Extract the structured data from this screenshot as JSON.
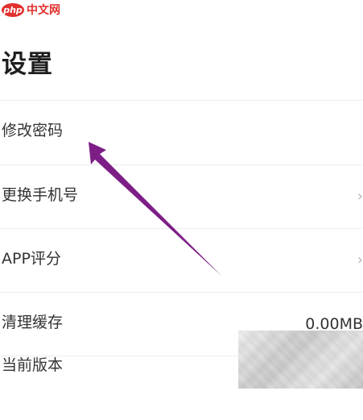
{
  "watermark": {
    "logo_text": "php",
    "site_text": "中文网"
  },
  "header": {
    "title": "设置"
  },
  "settings": {
    "items": [
      {
        "label": "修改密码"
      },
      {
        "label": "更换手机号"
      },
      {
        "label": "APP评分"
      },
      {
        "label": "清理缓存",
        "value": "0.00MB"
      },
      {
        "label": "当前版本"
      }
    ]
  },
  "annotation": {
    "arrow_color": "#7d1e86"
  }
}
